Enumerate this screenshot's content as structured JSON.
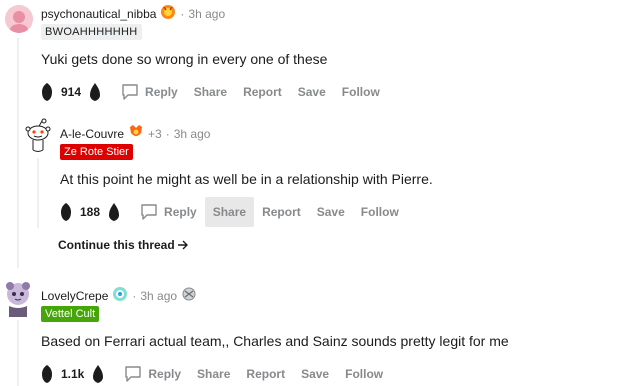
{
  "comments": [
    {
      "username": "psychonautical_nibba",
      "time": "3h ago",
      "flair": "BWOAHHHHHHH",
      "body": "Yuki gets done so wrong in every one of these",
      "score": "914",
      "actions": [
        "Reply",
        "Share",
        "Report",
        "Save",
        "Follow"
      ]
    },
    {
      "username": "A-le-Couvre",
      "extra_awards": "+3",
      "time": "3h ago",
      "flair": "Ze Rote Stier",
      "body": "At this point he might as well be in a relationship with Pierre.",
      "score": "188",
      "actions": [
        "Reply",
        "Share",
        "Report",
        "Save",
        "Follow"
      ]
    },
    {
      "username": "LovelyCrepe",
      "time": "3h ago",
      "flair": "Vettel Cult",
      "body": "Based on Ferrari actual team,, Charles and Sainz sounds pretty legit for me",
      "score": "1.1k",
      "actions": [
        "Reply",
        "Share",
        "Report",
        "Save",
        "Follow"
      ]
    }
  ],
  "continue_thread": "Continue this thread",
  "dot": "·",
  "colors": {
    "flair_red": "#dc0000",
    "flair_green": "#46a508",
    "meta_gray": "#878a8c",
    "thread_line": "#edeff1"
  }
}
